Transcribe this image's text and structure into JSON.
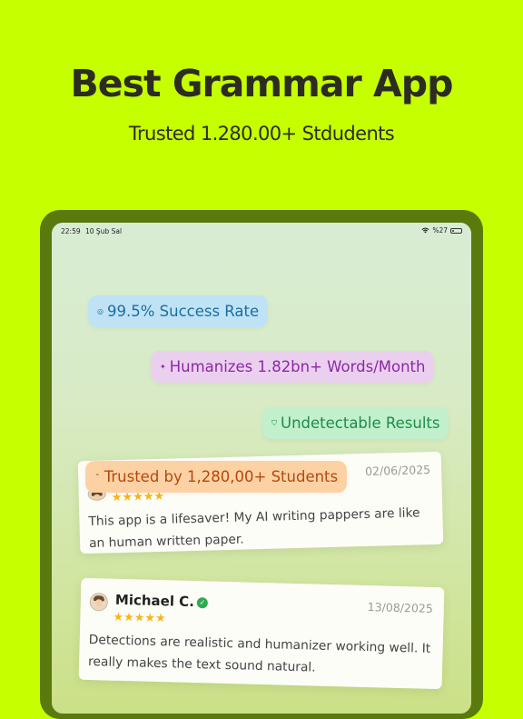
{
  "hero": {
    "title": "Best Grammar App",
    "subtitle": "Trusted 1.280.00+ Stdudents"
  },
  "status_bar": {
    "time": "22:59",
    "date": "10 Şub Sal",
    "battery": "%27",
    "battery_level": 0.27,
    "wifi_icon": "wifi-icon",
    "battery_icon": "battery-icon"
  },
  "badges": [
    {
      "label": "99.5% Success Rate",
      "icon": "target-icon",
      "background": "#bfe3f5",
      "color": "#1b6ea0"
    },
    {
      "label": "Humanizes 1.82bn+ Words/Month",
      "icon": "sparkle-icon",
      "background": "#ead0ee",
      "color": "#8c27a8"
    },
    {
      "label": "Undetectable Results",
      "icon": "shield-icon",
      "background": "#c2f0cd",
      "color": "#1e8c4a"
    },
    {
      "label": "Trusted by 1,280,00+ Students",
      "icon": "users-icon",
      "background": "#fcd2a5",
      "color": "#b7470c"
    }
  ],
  "reviews": [
    {
      "name": "",
      "date": "02/06/2025",
      "rating": 5,
      "stars": "★★★★★",
      "text": "This app is a lifesaver! My AI writing pappers are like an human written paper."
    },
    {
      "name": "Michael C.",
      "verified": "✓",
      "date": "13/08/2025",
      "rating": 5,
      "stars": "★★★★★",
      "text": "Detections are realistic and humanizer working well. It really makes the text sound natural."
    }
  ],
  "colors": {
    "page_background": "#c6ff00",
    "device_frame": "#5b7a0d",
    "star": "#f7b615",
    "verified": "#2eaa52"
  }
}
